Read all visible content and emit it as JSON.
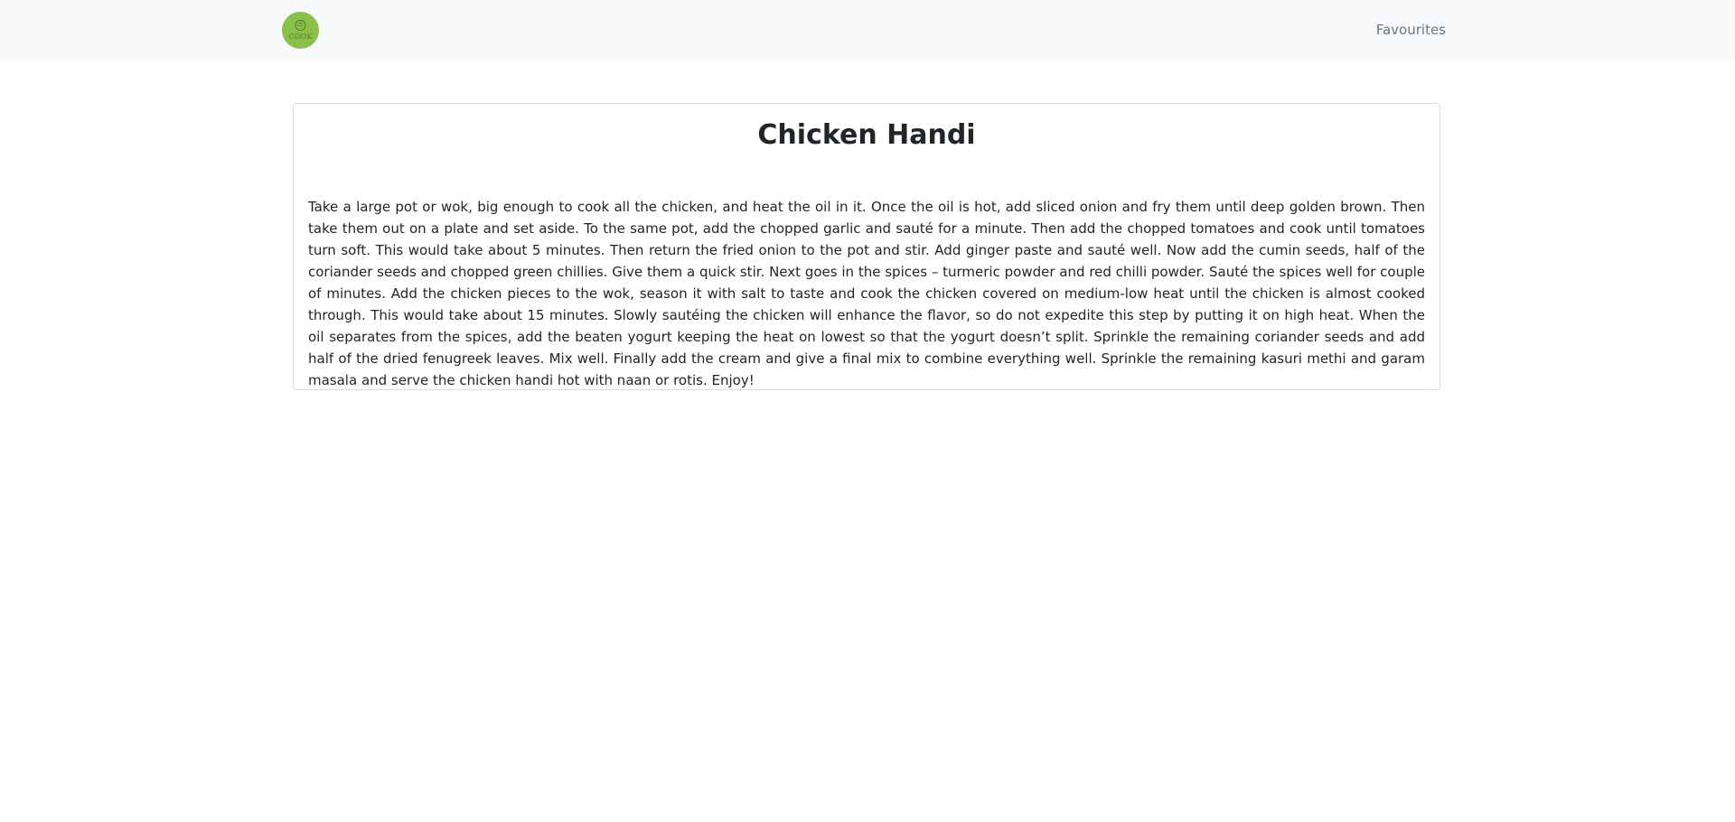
{
  "navbar": {
    "logo_text": "COOK",
    "favourites_label": "Favourites"
  },
  "recipe": {
    "title": "Chicken Handi",
    "instructions": "Take a large pot or wok, big enough to cook all the chicken, and heat the oil in it. Once the oil is hot, add sliced onion and fry them until deep golden brown. Then take them out on a plate and set aside. To the same pot, add the chopped garlic and sauté for a minute. Then add the chopped tomatoes and cook until tomatoes turn soft. This would take about 5 minutes. Then return the fried onion to the pot and stir. Add ginger paste and sauté well. Now add the cumin seeds, half of the coriander seeds and chopped green chillies. Give them a quick stir. Next goes in the spices – turmeric powder and red chilli powder. Sauté the spices well for couple of minutes. Add the chicken pieces to the wok, season it with salt to taste and cook the chicken covered on medium-low heat until the chicken is almost cooked through. This would take about 15 minutes. Slowly sautéing the chicken will enhance the flavor, so do not expedite this step by putting it on high heat. When the oil separates from the spices, add the beaten yogurt keeping the heat on lowest so that the yogurt doesn’t split. Sprinkle the remaining coriander seeds and add half of the dried fenugreek leaves. Mix well. Finally add the cream and give a final mix to combine everything well. Sprinkle the remaining kasuri methi and garam masala and serve the chicken handi hot with naan or rotis. Enjoy!"
  },
  "colors": {
    "navbar_bg": "#f8f9fa",
    "logo_bg": "#8bc14a",
    "nav_link": "#6c757d",
    "card_border": "#d9dcdf",
    "text": "#212529"
  }
}
